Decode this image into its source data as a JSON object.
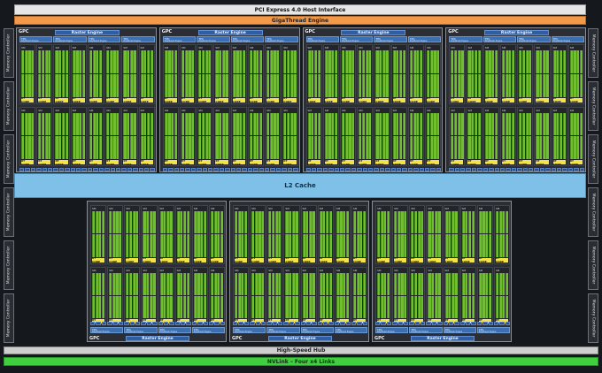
{
  "top": {
    "pcie_label": "PCI Express 4.0 Host Interface",
    "gigathread_label": "GigaThread Engine",
    "l2_label": "L2 Cache",
    "hub_label": "High-Speed Hub",
    "nvlink_label": "NVLink – Four x4 Links"
  },
  "memory_controller_label": "Memory Controller",
  "memory_controllers_left_count": 6,
  "memory_controllers_right_count": 6,
  "gpc": {
    "label": "GPC",
    "raster_label": "Raster Engine",
    "tpc_label": "TPC",
    "polymorph_label": "PolyMorph Engine",
    "sm_label": "SM",
    "rt_core_label": "RT CORE"
  },
  "layout": {
    "top_gpcs": 4,
    "bottom_gpcs": 3,
    "tpc_per_gpc": 4,
    "sm_per_tpc": 2
  },
  "colors": {
    "cuda_core": "#6fbf2e",
    "rt_core": "#f3e24a",
    "raster": "#2f5ea3",
    "l2_cache": "#7fc0e8",
    "gigathread": "#f2994a",
    "nvlink": "#3fcf3f"
  }
}
